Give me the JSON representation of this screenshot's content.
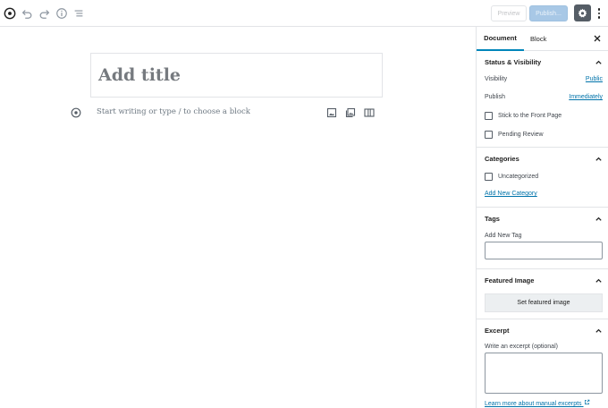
{
  "toolbar": {
    "preview_label": "Preview",
    "publish_label": "Publish..."
  },
  "editor": {
    "title_placeholder": "Add title",
    "block_placeholder": "Start writing or type / to choose a block"
  },
  "sidebar": {
    "tabs": [
      {
        "label": "Document",
        "active": true
      },
      {
        "label": "Block",
        "active": false
      }
    ],
    "status_visibility": {
      "title": "Status & Visibility",
      "visibility_label": "Visibility",
      "visibility_value": "Public",
      "publish_label": "Publish",
      "publish_value": "Immediately",
      "stick_label": "Stick to the Front Page",
      "pending_label": "Pending Review"
    },
    "categories": {
      "title": "Categories",
      "items": [
        {
          "label": "Uncategorized",
          "checked": false
        }
      ],
      "add_link": "Add New Category"
    },
    "tags": {
      "title": "Tags",
      "field_label": "Add New Tag",
      "value": ""
    },
    "featured_image": {
      "title": "Featured Image",
      "button_label": "Set featured image"
    },
    "excerpt": {
      "title": "Excerpt",
      "field_label": "Write an excerpt (optional)",
      "value": "",
      "learn_more": "Learn more about manual excerpts"
    }
  },
  "colors": {
    "accent": "#0085ba",
    "link": "#0073aa",
    "publish_disabled": "#a8c8e6",
    "settings_active": "#555d66"
  },
  "icons": [
    "add-block-icon",
    "undo-icon",
    "redo-icon",
    "info-icon",
    "outline-icon",
    "gear-icon",
    "more-vertical-icon",
    "close-icon",
    "chevron-up-icon",
    "image-icon",
    "gallery-icon",
    "columns-icon",
    "external-link-icon"
  ]
}
